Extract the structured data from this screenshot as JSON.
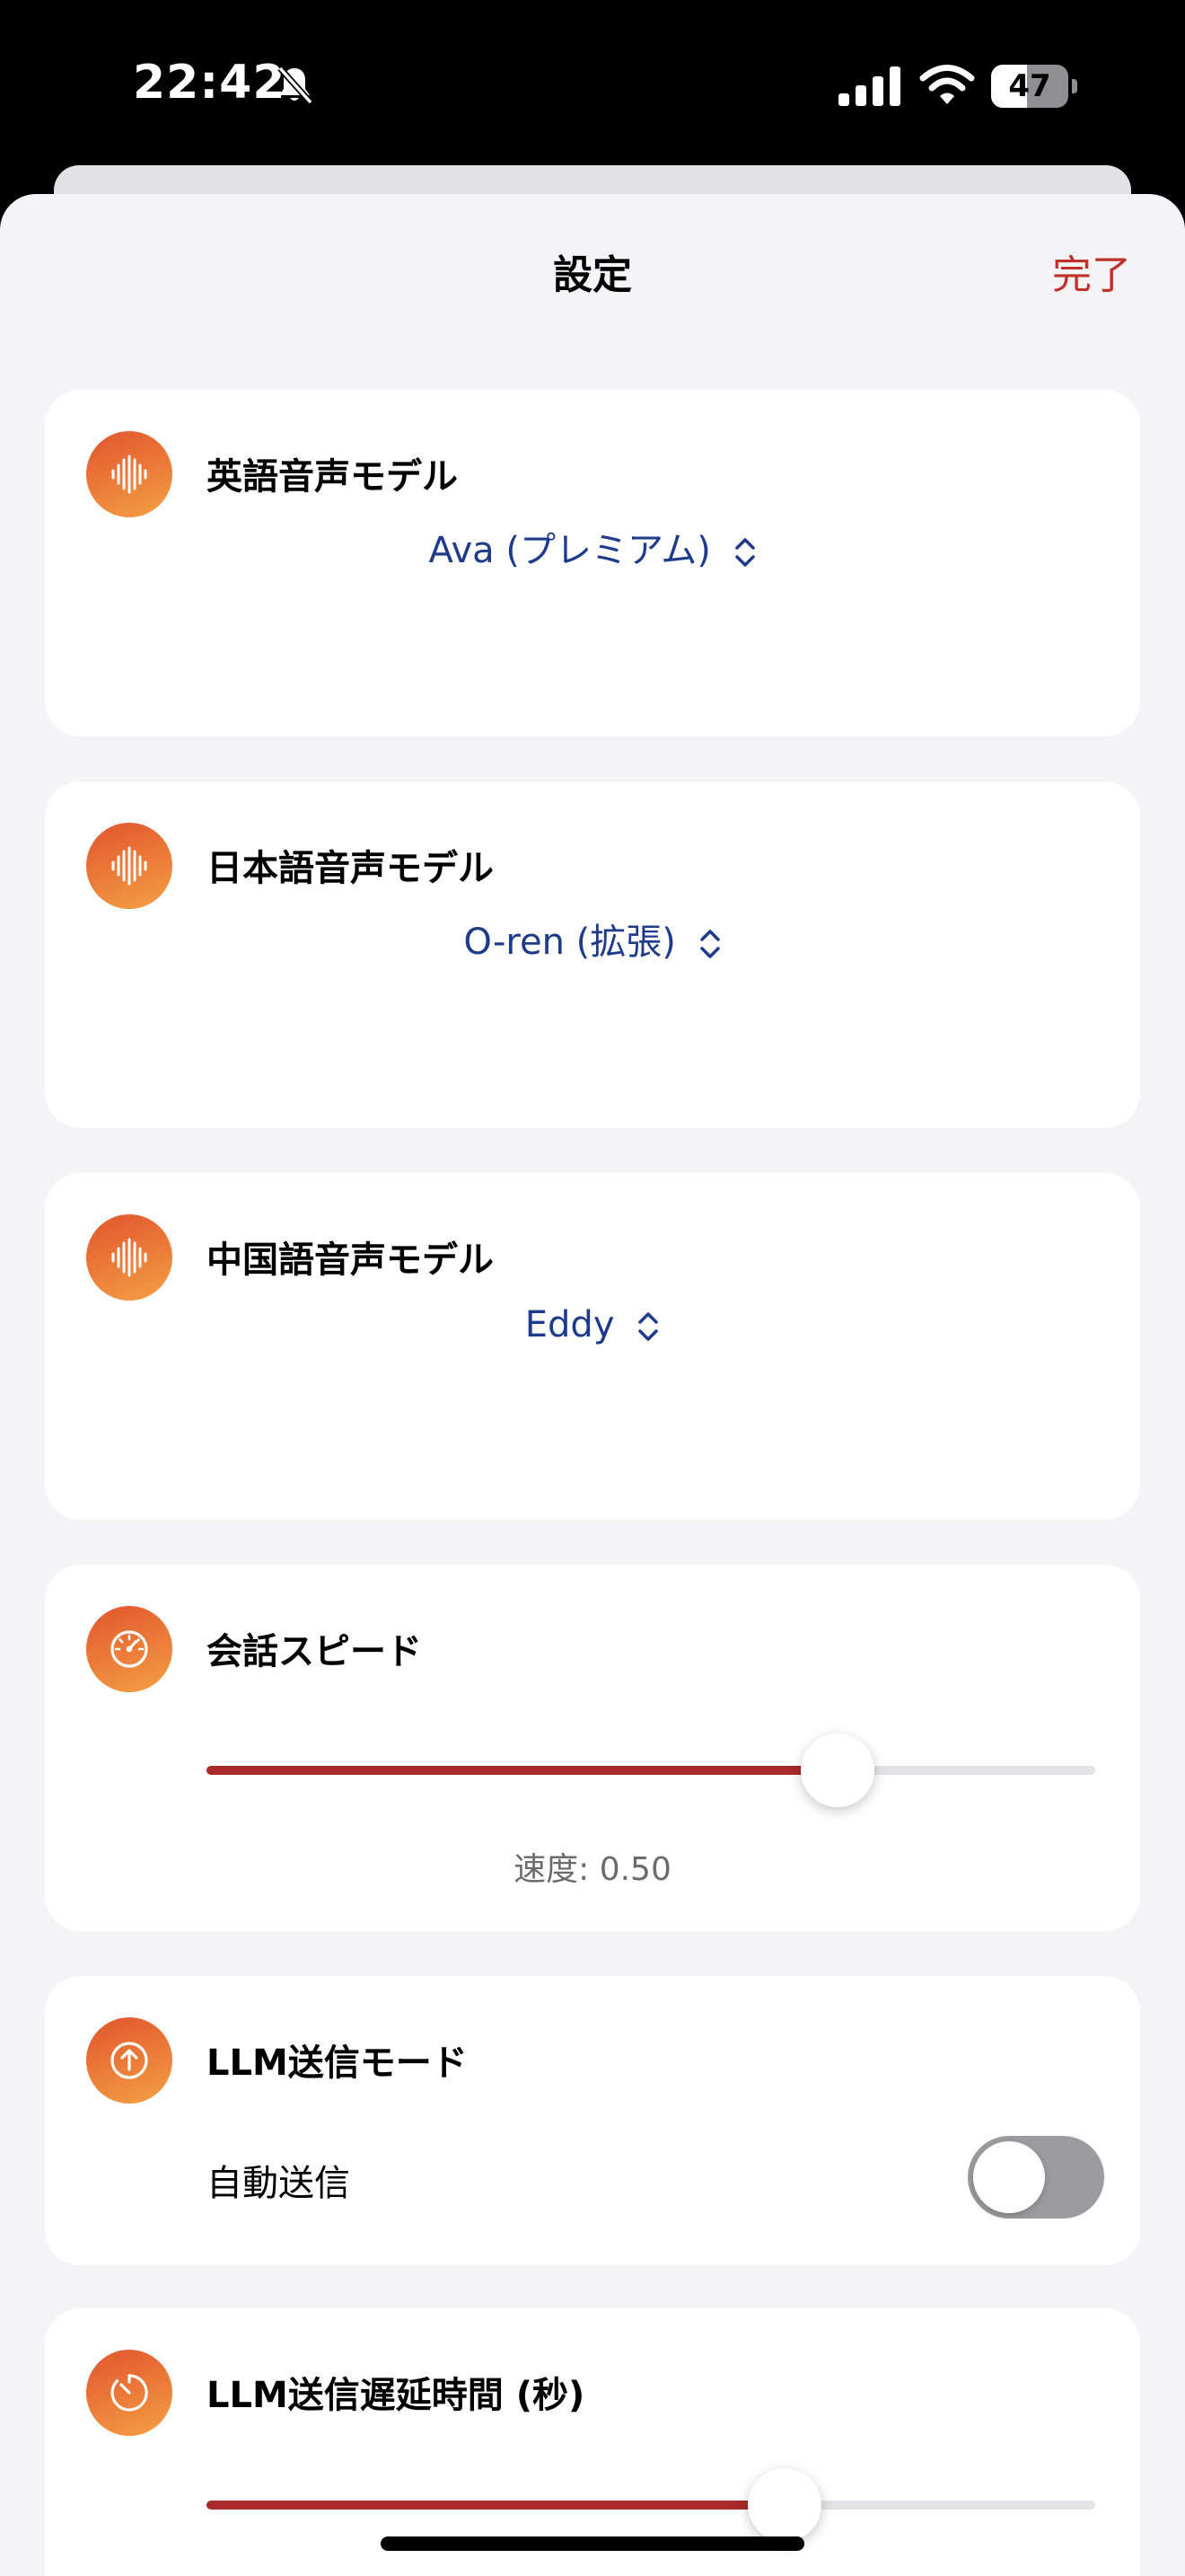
{
  "status_bar": {
    "time": "22:42",
    "battery_percent": "47",
    "icons": [
      "bell-slash-icon",
      "cellular-signal-icon",
      "wifi-icon",
      "battery-icon"
    ]
  },
  "nav": {
    "title": "設定",
    "done_label": "完了"
  },
  "cards": {
    "english_voice": {
      "icon": "waveform-icon",
      "title": "英語音声モデル",
      "value": "Ava (プレミアム)"
    },
    "japanese_voice": {
      "icon": "waveform-icon",
      "title": "日本語音声モデル",
      "value": "O-ren (拡張)"
    },
    "chinese_voice": {
      "icon": "waveform-icon",
      "title": "中国語音声モデル",
      "value": "Eddy"
    },
    "speed": {
      "icon": "speedometer-icon",
      "title": "会話スピード",
      "slider_fraction": 0.71,
      "value_label": "速度: 0.50"
    },
    "llm_mode": {
      "icon": "arrow-up-circle-icon",
      "title": "LLM送信モード",
      "toggle_label": "自動送信",
      "toggle_on": false
    },
    "llm_delay": {
      "icon": "timer-icon",
      "title": "LLM送信遅延時間 (秒)",
      "slider_fraction": 0.65
    }
  },
  "colors": {
    "accent": "#c0312c",
    "slider_fill": "#a82a2a",
    "picker_text": "#1e3a8a",
    "icon_gradient_start": "#e1542e",
    "icon_gradient_end": "#f4a043"
  }
}
